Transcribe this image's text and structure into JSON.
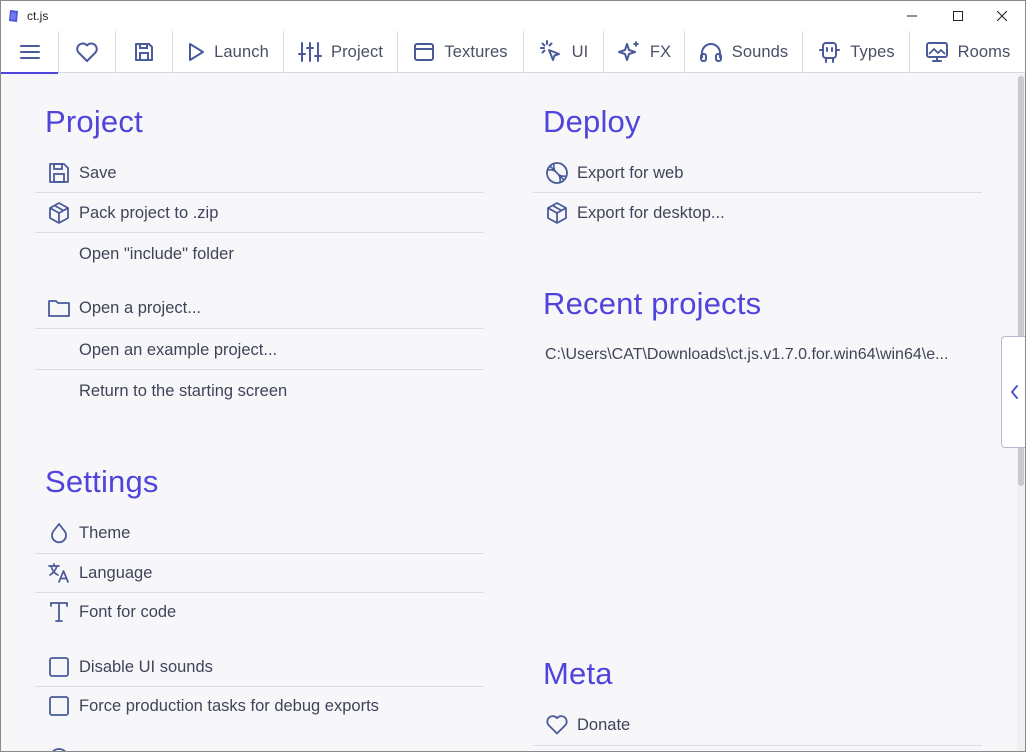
{
  "window": {
    "title": "ct.js"
  },
  "tabs": [
    {
      "id": "menu",
      "label": "",
      "icon": "hamburger-menu-icon"
    },
    {
      "id": "patrons",
      "label": "",
      "icon": "heart-icon"
    },
    {
      "id": "save",
      "label": "",
      "icon": "save-icon"
    },
    {
      "id": "launch",
      "label": "Launch",
      "icon": "play-icon"
    },
    {
      "id": "project",
      "label": "Project",
      "icon": "sliders-icon"
    },
    {
      "id": "textures",
      "label": "Textures",
      "icon": "texture-icon"
    },
    {
      "id": "ui",
      "label": "UI",
      "icon": "pointer-click-icon"
    },
    {
      "id": "fx",
      "label": "FX",
      "icon": "sparkles-icon"
    },
    {
      "id": "sounds",
      "label": "Sounds",
      "icon": "headphones-icon"
    },
    {
      "id": "types",
      "label": "Types",
      "icon": "robot-icon"
    },
    {
      "id": "rooms",
      "label": "Rooms",
      "icon": "monitor-image-icon"
    }
  ],
  "project": {
    "heading": "Project",
    "items": [
      {
        "label": "Save",
        "icon": "save-icon"
      },
      {
        "label": "Pack project to .zip",
        "icon": "package-icon"
      },
      {
        "label": "Open \"include\" folder",
        "icon": ""
      },
      {
        "label": "Open a project...",
        "icon": "folder-icon"
      },
      {
        "label": "Open an example project...",
        "icon": ""
      },
      {
        "label": "Return to the starting screen",
        "icon": ""
      }
    ]
  },
  "settings": {
    "heading": "Settings",
    "items": [
      {
        "label": "Theme",
        "icon": "droplet-icon"
      },
      {
        "label": "Language",
        "icon": "translate-icon"
      },
      {
        "label": "Font for code",
        "icon": "type-icon"
      },
      {
        "label": "Disable UI sounds",
        "icon": "checkbox-icon"
      },
      {
        "label": "Force production tasks for debug exports",
        "icon": "checkbox-icon"
      }
    ]
  },
  "deploy": {
    "heading": "Deploy",
    "items": [
      {
        "label": "Export for web",
        "icon": "globe-icon"
      },
      {
        "label": "Export for desktop...",
        "icon": "package-icon"
      }
    ]
  },
  "recent": {
    "heading": "Recent projects",
    "items": [
      "C:\\Users\\CAT\\Downloads\\ct.js.v1.7.0.for.win64\\win64\\e..."
    ]
  },
  "meta": {
    "heading": "Meta",
    "items": [
      {
        "label": "Donate",
        "icon": "heart-icon"
      }
    ]
  },
  "colors": {
    "accent": "#5144db",
    "icon": "#4a5a9a",
    "text": "#3f4458",
    "background": "#f7f7fa"
  }
}
